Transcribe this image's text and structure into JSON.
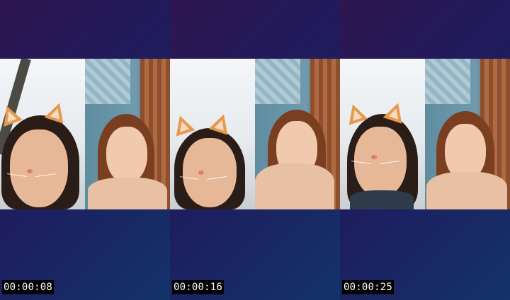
{
  "frames": [
    {
      "timestamp": "00:00:08"
    },
    {
      "timestamp": "00:00:16"
    },
    {
      "timestamp": "00:00:25"
    }
  ],
  "colors": {
    "background_gradient": [
      "#2e1650",
      "#1f1c5e",
      "#13336a"
    ],
    "timestamp_bg": "#000000",
    "timestamp_text": "#ffffff"
  },
  "icons": [
    "cat-ear-filter-icon",
    "cat-nose-filter-icon"
  ]
}
